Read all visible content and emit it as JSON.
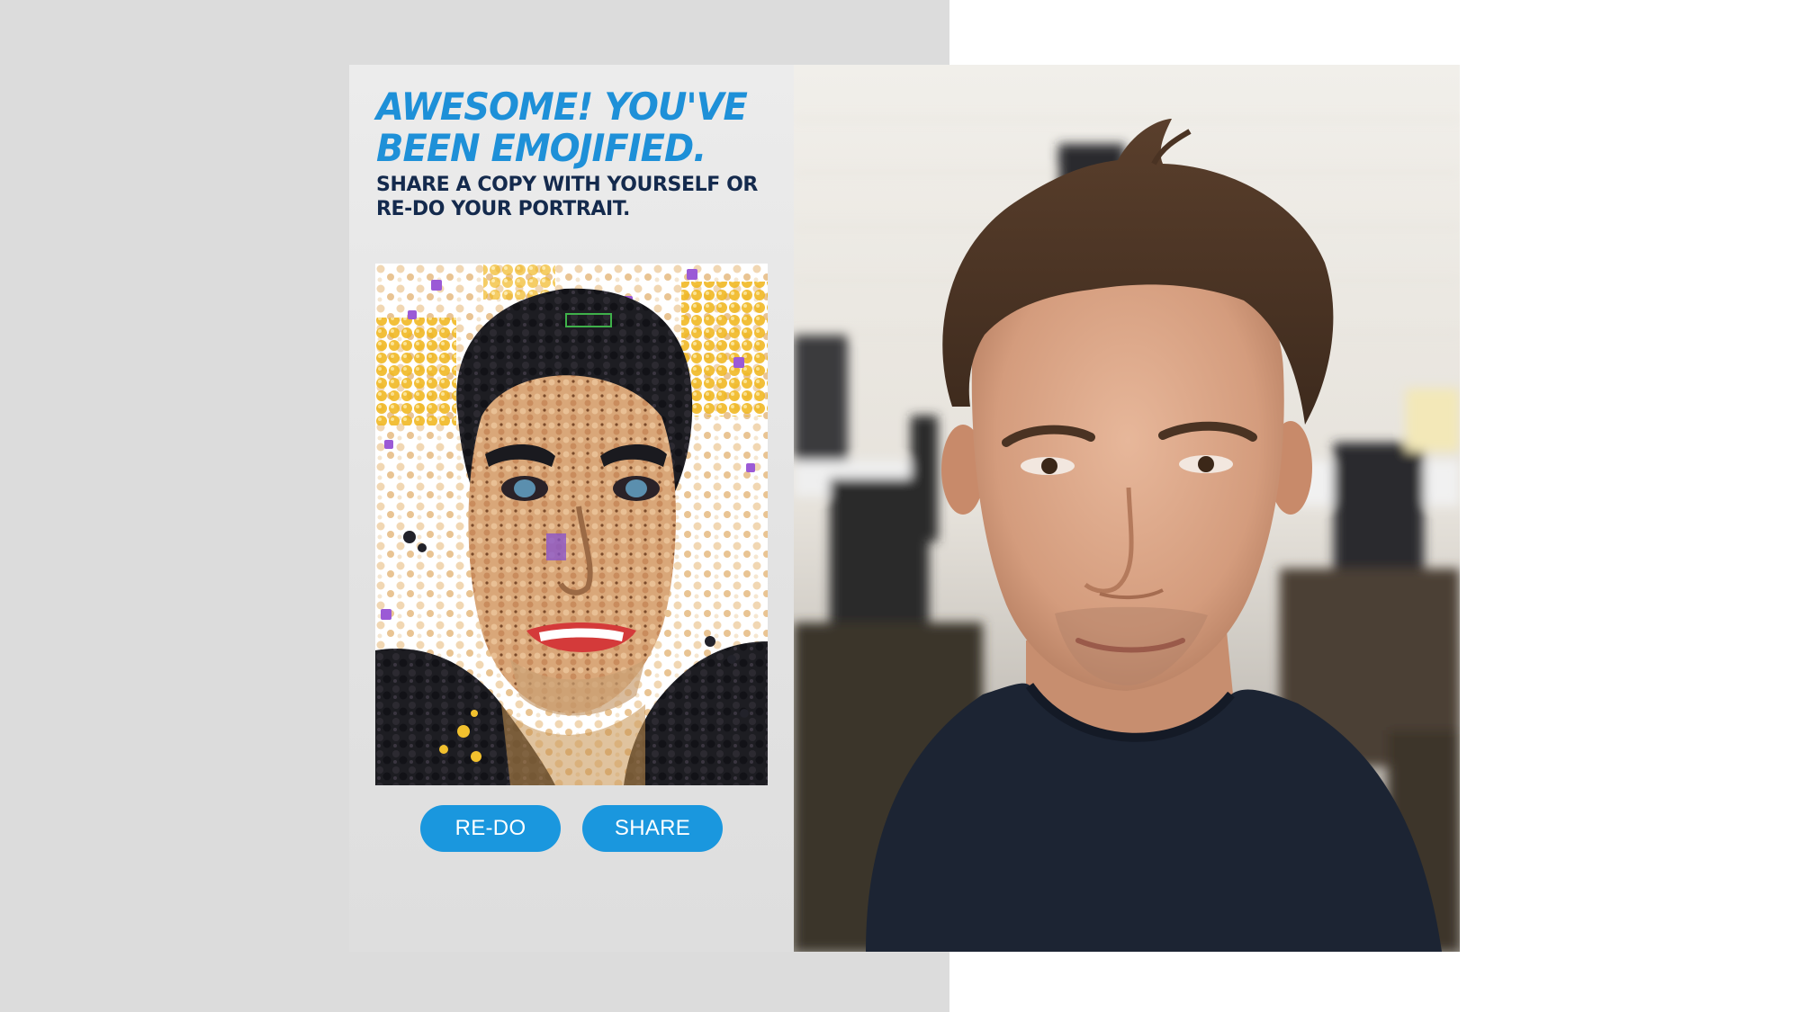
{
  "header": {
    "headline": "AWESOME! YOU'VE BEEN EMOJIFIED.",
    "subline": "SHARE A COPY WITH YOURSELF OR RE-DO YOUR PORTRAIT."
  },
  "actions": {
    "redo_label": "RE-DO",
    "share_label": "SHARE"
  },
  "colors": {
    "accent": "#1a97de",
    "headline": "#1e90d8",
    "subline": "#142a4d",
    "stage_left": "#dcdcdc",
    "stage_right": "#ffffff"
  }
}
